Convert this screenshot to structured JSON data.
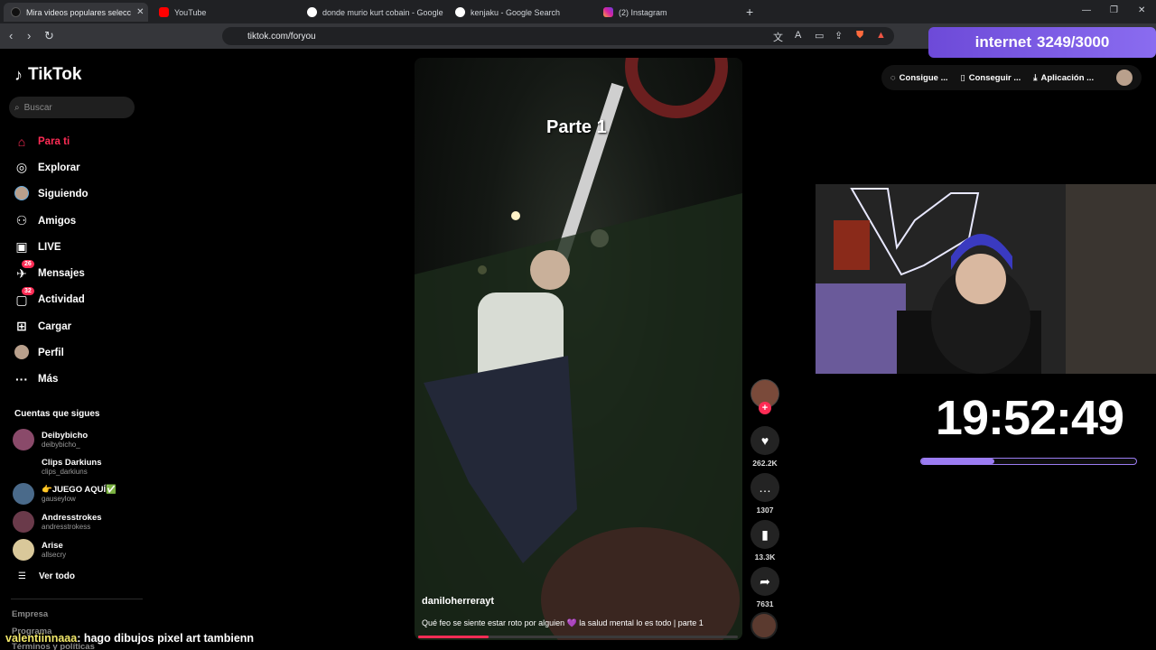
{
  "browser": {
    "tabs": [
      {
        "label": "Mira videos populares selecc",
        "active": true
      },
      {
        "label": "YouTube",
        "active": false
      },
      {
        "label": "donde murio kurt cobain - Google S",
        "active": false
      },
      {
        "label": "kenjaku - Google Search",
        "active": false
      },
      {
        "label": "(2) Instagram",
        "active": false
      }
    ],
    "url": "tiktok.com/foryou"
  },
  "overlay": {
    "internet_label": "internet",
    "internet_count": "3249/3000",
    "clock": "19:52:49",
    "clock_progress": 0.34,
    "chat_user": "valentiinnaaa",
    "chat_message": ": hago dibujos pixel art tambienn"
  },
  "sidebar": {
    "logo": "TikTok",
    "search_placeholder": "Buscar",
    "nav": [
      {
        "label": "Para ti",
        "icon": "home-icon"
      },
      {
        "label": "Explorar",
        "icon": "compass-icon"
      },
      {
        "label": "Siguiendo",
        "icon": "avatar-icon"
      },
      {
        "label": "Amigos",
        "icon": "friends-icon"
      },
      {
        "label": "LIVE",
        "icon": "live-icon"
      },
      {
        "label": "Mensajes",
        "icon": "messages-icon",
        "badge": "26"
      },
      {
        "label": "Actividad",
        "icon": "activity-icon",
        "badge": "32"
      },
      {
        "label": "Cargar",
        "icon": "upload-icon"
      },
      {
        "label": "Perfil",
        "icon": "profile-icon"
      },
      {
        "label": "Más",
        "icon": "more-icon"
      }
    ],
    "following_title": "Cuentas que sigues",
    "accounts": [
      {
        "name": "Deibybicho",
        "handle": "deibybicho_"
      },
      {
        "name": "Clips Darkiuns",
        "handle": "clips_darkiuns"
      },
      {
        "name": "👉JUEGO AQUÍ✅",
        "handle": "gauseylow"
      },
      {
        "name": "Andresstrokes",
        "handle": "andresstrokess"
      },
      {
        "name": "Arise",
        "handle": "allsecry"
      }
    ],
    "see_all": "Ver todo",
    "footer": [
      "Empresa",
      "Programa",
      "Términos y políticas"
    ]
  },
  "video": {
    "overlay_text": "Parte 1",
    "author": "daniloherrerayt",
    "description": "Qué feo se siente estar roto por alguien 💜 la salud mental lo es todo | parte 1",
    "progress": 0.22,
    "likes": "262.2K",
    "comments": "1307",
    "saves": "13.3K",
    "shares": "7631"
  },
  "top_actions": {
    "coins": "Consigue ...",
    "app": "Conseguir ...",
    "download": "Aplicación ..."
  }
}
